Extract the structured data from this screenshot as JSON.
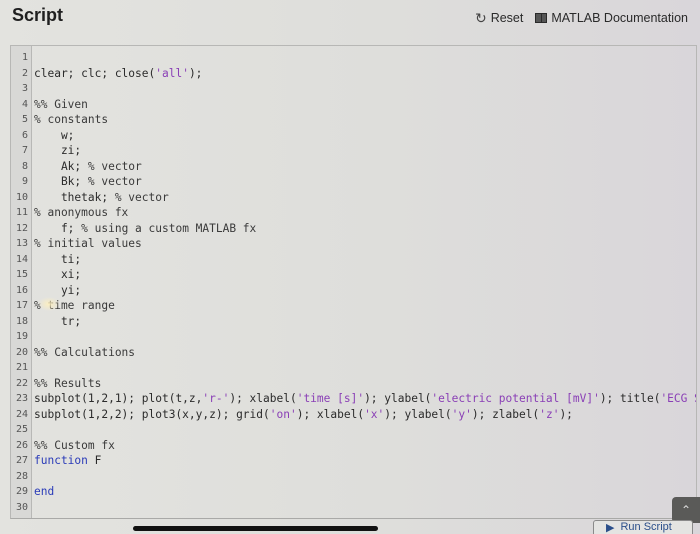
{
  "header": {
    "title": "Script",
    "reset_label": "Reset",
    "reset_icon": "refresh-icon",
    "docs_label": "MATLAB Documentation",
    "docs_icon": "book-icon"
  },
  "editor": {
    "lines": [
      {
        "n": "1",
        "segments": []
      },
      {
        "n": "2",
        "segments": [
          {
            "t": "clear; clc; close(",
            "c": ""
          },
          {
            "t": "'all'",
            "c": "str"
          },
          {
            "t": ");",
            "c": ""
          }
        ]
      },
      {
        "n": "3",
        "segments": []
      },
      {
        "n": "4",
        "segments": [
          {
            "t": "%% Given",
            "c": "comment"
          }
        ]
      },
      {
        "n": "5",
        "segments": [
          {
            "t": "% constants",
            "c": "comment"
          }
        ]
      },
      {
        "n": "6",
        "segments": [
          {
            "t": "    w;",
            "c": ""
          }
        ]
      },
      {
        "n": "7",
        "segments": [
          {
            "t": "    zi;",
            "c": ""
          }
        ]
      },
      {
        "n": "8",
        "segments": [
          {
            "t": "    Ak; ",
            "c": ""
          },
          {
            "t": "% vector",
            "c": "comment"
          }
        ]
      },
      {
        "n": "9",
        "segments": [
          {
            "t": "    Bk; ",
            "c": ""
          },
          {
            "t": "% vector",
            "c": "comment"
          }
        ]
      },
      {
        "n": "10",
        "segments": [
          {
            "t": "    thetak; ",
            "c": ""
          },
          {
            "t": "% vector",
            "c": "comment"
          }
        ]
      },
      {
        "n": "11",
        "segments": [
          {
            "t": "% anonymous fx",
            "c": "comment"
          }
        ]
      },
      {
        "n": "12",
        "segments": [
          {
            "t": "    f; ",
            "c": ""
          },
          {
            "t": "% using a custom MATLAB fx",
            "c": "comment"
          }
        ]
      },
      {
        "n": "13",
        "segments": [
          {
            "t": "% initial values",
            "c": "comment"
          }
        ]
      },
      {
        "n": "14",
        "segments": [
          {
            "t": "    ti;",
            "c": ""
          }
        ]
      },
      {
        "n": "15",
        "segments": [
          {
            "t": "    xi;",
            "c": ""
          }
        ]
      },
      {
        "n": "16",
        "segments": [
          {
            "t": "    yi;",
            "c": ""
          }
        ]
      },
      {
        "n": "17",
        "segments": [
          {
            "t": "% time range",
            "c": "comment"
          }
        ]
      },
      {
        "n": "18",
        "segments": [
          {
            "t": "    tr;",
            "c": ""
          }
        ]
      },
      {
        "n": "19",
        "segments": []
      },
      {
        "n": "20",
        "segments": [
          {
            "t": "%% Calculations",
            "c": "comment"
          }
        ]
      },
      {
        "n": "21",
        "segments": []
      },
      {
        "n": "22",
        "segments": [
          {
            "t": "%% Results",
            "c": "comment"
          }
        ]
      },
      {
        "n": "23",
        "segments": [
          {
            "t": "subplot(1,2,1); plot(t,z,",
            "c": ""
          },
          {
            "t": "'r-'",
            "c": "str"
          },
          {
            "t": "); xlabel(",
            "c": ""
          },
          {
            "t": "'time [s]'",
            "c": "str"
          },
          {
            "t": "); ylabel(",
            "c": ""
          },
          {
            "t": "'electric potential [mV]'",
            "c": "str"
          },
          {
            "t": "); title(",
            "c": ""
          },
          {
            "t": "'ECG Signal'",
            "c": "str"
          }
        ]
      },
      {
        "n": "24",
        "segments": [
          {
            "t": "subplot(1,2,2); plot3(x,y,z); grid(",
            "c": ""
          },
          {
            "t": "'on'",
            "c": "str"
          },
          {
            "t": "); xlabel(",
            "c": ""
          },
          {
            "t": "'x'",
            "c": "str"
          },
          {
            "t": "); ylabel(",
            "c": ""
          },
          {
            "t": "'y'",
            "c": "str"
          },
          {
            "t": "); zlabel(",
            "c": ""
          },
          {
            "t": "'z'",
            "c": "str"
          },
          {
            "t": ");",
            "c": ""
          }
        ]
      },
      {
        "n": "25",
        "segments": []
      },
      {
        "n": "26",
        "segments": [
          {
            "t": "%% Custom fx",
            "c": "comment"
          }
        ]
      },
      {
        "n": "27",
        "segments": [
          {
            "t": "function",
            "c": "kw"
          },
          {
            "t": " F",
            "c": ""
          }
        ]
      },
      {
        "n": "28",
        "segments": []
      },
      {
        "n": "29",
        "segments": [
          {
            "t": "end",
            "c": "kw"
          }
        ]
      },
      {
        "n": "30",
        "segments": []
      }
    ]
  },
  "footer": {
    "run_label": "Run Script",
    "run_icon": "play-icon",
    "scroll_top_icon": "chevron-up-icon"
  }
}
